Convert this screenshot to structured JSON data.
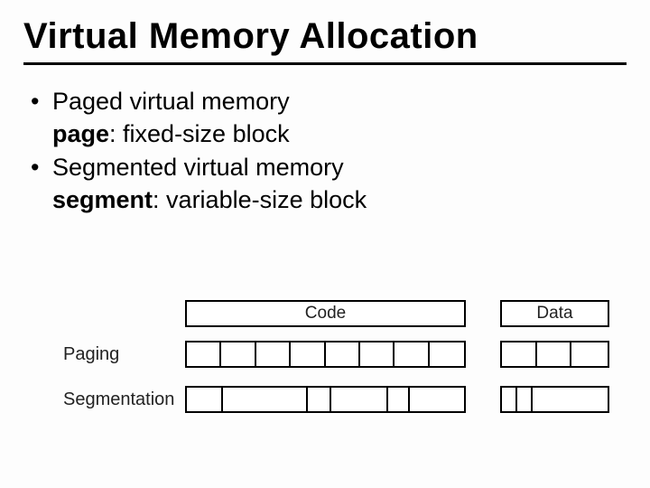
{
  "title": "Virtual Memory Allocation",
  "bullets": {
    "b1": "Paged virtual memory",
    "s1_bold": "page",
    "s1_rest": ": fixed-size block",
    "b2": "Segmented virtual memory",
    "s2_bold": "segment",
    "s2_rest": ": variable-size block"
  },
  "diagram": {
    "code_label": "Code",
    "data_label": "Data",
    "row_paging": "Paging",
    "row_segmentation": "Segmentation",
    "code_width": 311,
    "data_width": 121,
    "paging_page_w": 38.5,
    "seg_code_cells": [
      40,
      96,
      26,
      64,
      24,
      61
    ],
    "seg_data_cells": [
      18,
      17,
      86
    ]
  }
}
